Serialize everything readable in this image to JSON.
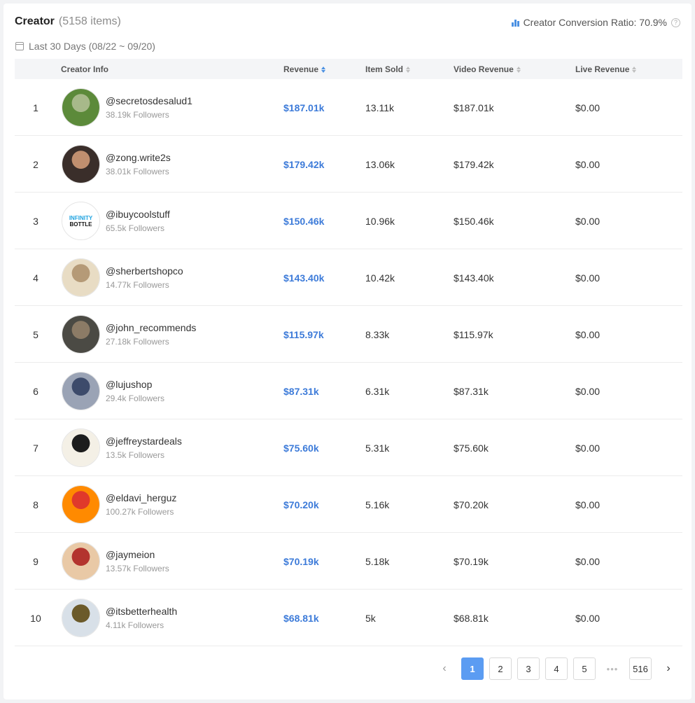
{
  "header": {
    "title": "Creator",
    "count": "(5158 items)",
    "ratio_label": "Creator Conversion Ratio: 70.9%",
    "date_range": "Last 30 Days (08/22 ~ 09/20)"
  },
  "columns": {
    "creator_info": "Creator Info",
    "revenue": "Revenue",
    "item_sold": "Item Sold",
    "video_revenue": "Video Revenue",
    "live_revenue": "Live Revenue"
  },
  "rows": [
    {
      "rank": "1",
      "handle": "@secretosdesalud1",
      "followers": "38.19k Followers",
      "revenue": "$187.01k",
      "sold": "13.11k",
      "video": "$187.01k",
      "live": "$0.00",
      "colors": [
        "#5c8a3a",
        "#a7b98a"
      ]
    },
    {
      "rank": "2",
      "handle": "@zong.write2s",
      "followers": "38.01k Followers",
      "revenue": "$179.42k",
      "sold": "13.06k",
      "video": "$179.42k",
      "live": "$0.00",
      "colors": [
        "#3a2e2a",
        "#c08f6f"
      ]
    },
    {
      "rank": "3",
      "handle": "@ibuycoolstuff",
      "followers": "65.5k Followers",
      "revenue": "$150.46k",
      "sold": "10.96k",
      "video": "$150.46k",
      "live": "$0.00",
      "colors": [
        "#ffffff",
        "#ffffff"
      ],
      "logo": true,
      "logo_top": "INFINITY",
      "logo_bottom": "BOTTLE"
    },
    {
      "rank": "4",
      "handle": "@sherbertshopco",
      "followers": "14.77k Followers",
      "revenue": "$143.40k",
      "sold": "10.42k",
      "video": "$143.40k",
      "live": "$0.00",
      "colors": [
        "#e8dcc4",
        "#b59a77"
      ]
    },
    {
      "rank": "5",
      "handle": "@john_recommends",
      "followers": "27.18k Followers",
      "revenue": "$115.97k",
      "sold": "8.33k",
      "video": "$115.97k",
      "live": "$0.00",
      "colors": [
        "#4b4a44",
        "#8c7b66"
      ]
    },
    {
      "rank": "6",
      "handle": "@lujushop",
      "followers": "29.4k Followers",
      "revenue": "$87.31k",
      "sold": "6.31k",
      "video": "$87.31k",
      "live": "$0.00",
      "colors": [
        "#9aa3b5",
        "#3d4b6b"
      ]
    },
    {
      "rank": "7",
      "handle": "@jeffreystardeals",
      "followers": "13.5k Followers",
      "revenue": "$75.60k",
      "sold": "5.31k",
      "video": "$75.60k",
      "live": "$0.00",
      "colors": [
        "#f4f0e6",
        "#1d1d1d"
      ]
    },
    {
      "rank": "8",
      "handle": "@eldavi_herguz",
      "followers": "100.27k Followers",
      "revenue": "$70.20k",
      "sold": "5.16k",
      "video": "$70.20k",
      "live": "$0.00",
      "colors": [
        "#ff8a00",
        "#e0392b"
      ]
    },
    {
      "rank": "9",
      "handle": "@jaymeion",
      "followers": "13.57k Followers",
      "revenue": "$70.19k",
      "sold": "5.18k",
      "video": "$70.19k",
      "live": "$0.00",
      "colors": [
        "#e9c9a6",
        "#b3342e"
      ]
    },
    {
      "rank": "10",
      "handle": "@itsbetterhealth",
      "followers": "4.11k Followers",
      "revenue": "$68.81k",
      "sold": "5k",
      "video": "$68.81k",
      "live": "$0.00",
      "colors": [
        "#d8e0e8",
        "#6b5a2a"
      ]
    }
  ],
  "pagination": {
    "prev": "‹",
    "pages": [
      "1",
      "2",
      "3",
      "4",
      "5"
    ],
    "dots": "•••",
    "last": "516",
    "next": "›",
    "current": "1"
  },
  "accent_color": "#4a90e2"
}
